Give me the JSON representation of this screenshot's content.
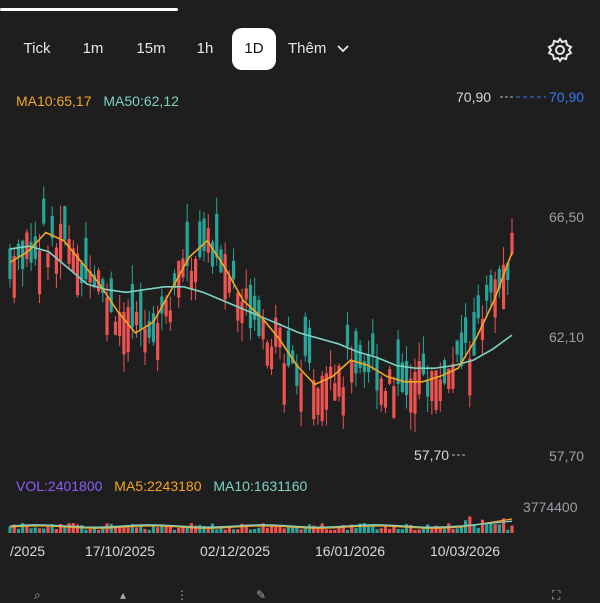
{
  "tabs": [
    {
      "label": "Tick",
      "active": false
    },
    {
      "label": "1m",
      "active": false
    },
    {
      "label": "15m",
      "active": false
    },
    {
      "label": "1h",
      "active": false
    },
    {
      "label": "1D",
      "active": true
    },
    {
      "label": "Thêm",
      "active": false
    }
  ],
  "legend": {
    "ma10": "MA10:65,17",
    "ma50": "MA50:62,12"
  },
  "volume_legend": {
    "vol": "VOL:2401800",
    "ma5": "MA5:2243180",
    "ma10": "MA10:1631160"
  },
  "price_labels": {
    "high_marker": "70,90",
    "low_marker": "57,70",
    "last_price": "70,90"
  },
  "y_axis": [
    "66,50",
    "62,10",
    "57,70"
  ],
  "volume_axis": "3774400",
  "x_axis": [
    "/2025",
    "17/10/2025",
    "02/12/2025",
    "16/01/2026",
    "10/03/2026"
  ],
  "colors": {
    "background": "#1e1e1e",
    "up": "#26a69a",
    "down": "#ef5350",
    "ma10": "#f5a623",
    "ma50": "#7fd1c4",
    "vol_legend": "#8e5cf7",
    "last_price": "#2f7bf6"
  },
  "icons": [
    "gear-icon",
    "chevron-down-icon"
  ],
  "chart_data": {
    "type": "candlestick",
    "ylim": [
      57.7,
      70.9
    ],
    "series": [
      {
        "name": "MA10",
        "values": [
          64.8,
          65.2,
          65.9,
          65.6,
          64.8,
          64.0,
          63.0,
          62.2,
          62.6,
          63.8,
          65.0,
          65.6,
          64.6,
          63.4,
          62.8,
          62.0,
          61.0,
          60.3,
          60.6,
          61.2,
          61.0,
          60.6,
          60.4,
          60.4,
          60.6,
          60.9,
          62.0,
          63.4,
          65.17
        ]
      },
      {
        "name": "MA50",
        "values": [
          65.3,
          65.4,
          65.2,
          64.6,
          64.0,
          63.8,
          63.7,
          63.8,
          63.9,
          63.9,
          63.7,
          63.4,
          63.1,
          62.8,
          62.5,
          62.2,
          62.0,
          61.8,
          61.5,
          61.3,
          61.0,
          60.9,
          60.9,
          61.0,
          61.2,
          61.6,
          62.12
        ]
      }
    ]
  }
}
